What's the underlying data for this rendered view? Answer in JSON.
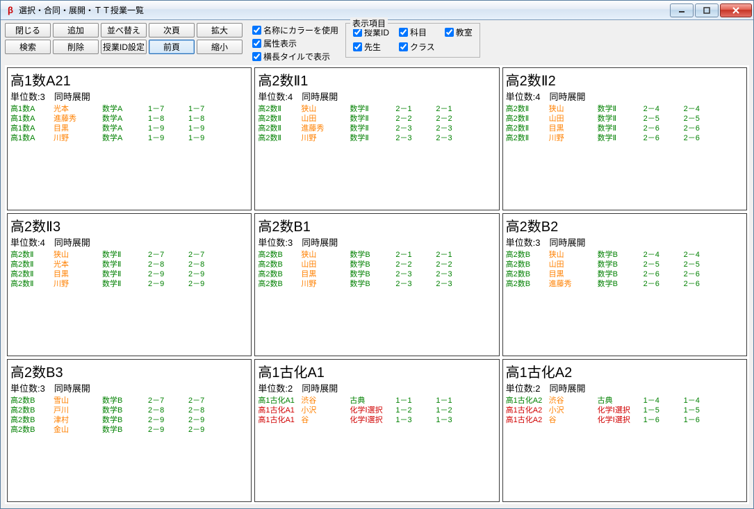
{
  "window": {
    "title": "選択・合同・展開・ＴＴ授業一覧"
  },
  "toolbar": {
    "buttons": [
      [
        "閉じる",
        "追加",
        "並べ替え",
        "次頁",
        "拡大"
      ],
      [
        "検索",
        "削除",
        "授業ID設定",
        "前頁",
        "縮小"
      ]
    ],
    "active": "前頁",
    "checks": {
      "name_color": "名称にカラーを使用",
      "attr_show": "属性表示",
      "tile_wide": "横長タイルで表示"
    },
    "fieldset": {
      "legend": "表示項目",
      "items": {
        "lesson_id": "授業ID",
        "subject": "科目",
        "room": "教室",
        "teacher": "先生",
        "class": "クラス"
      }
    }
  },
  "labels": {
    "units": "単位数:",
    "mode": "同時展開"
  },
  "cards": [
    {
      "title": "高1数A21",
      "units": "3",
      "rows": [
        {
          "id": "高1数A",
          "id_c": "green",
          "tch": "光本",
          "tch_c": "orange",
          "sub": "数学A",
          "sub_c": "green",
          "c1": "1－7",
          "c2": "1－7",
          "cl_c": "green"
        },
        {
          "id": "高1数A",
          "id_c": "green",
          "tch": "進藤秀",
          "tch_c": "orange",
          "sub": "数学A",
          "sub_c": "green",
          "c1": "1－8",
          "c2": "1－8",
          "cl_c": "green"
        },
        {
          "id": "高1数A",
          "id_c": "green",
          "tch": "目黒",
          "tch_c": "orange",
          "sub": "数学A",
          "sub_c": "green",
          "c1": "1－9",
          "c2": "1－9",
          "cl_c": "green"
        },
        {
          "id": "高1数A",
          "id_c": "green",
          "tch": "川野",
          "tch_c": "orange",
          "sub": "数学A",
          "sub_c": "green",
          "c1": "1－9",
          "c2": "1－9",
          "cl_c": "green"
        }
      ]
    },
    {
      "title": "高2数Ⅱ1",
      "units": "4",
      "rows": [
        {
          "id": "高2数Ⅱ",
          "id_c": "green",
          "tch": "狭山",
          "tch_c": "orange",
          "sub": "数学Ⅱ",
          "sub_c": "green",
          "c1": "2－1",
          "c2": "2－1",
          "cl_c": "green"
        },
        {
          "id": "高2数Ⅱ",
          "id_c": "green",
          "tch": "山田",
          "tch_c": "orange",
          "sub": "数学Ⅱ",
          "sub_c": "green",
          "c1": "2－2",
          "c2": "2－2",
          "cl_c": "green"
        },
        {
          "id": "高2数Ⅱ",
          "id_c": "green",
          "tch": "進藤秀",
          "tch_c": "orange",
          "sub": "数学Ⅱ",
          "sub_c": "green",
          "c1": "2－3",
          "c2": "2－3",
          "cl_c": "green"
        },
        {
          "id": "高2数Ⅱ",
          "id_c": "green",
          "tch": "川野",
          "tch_c": "orange",
          "sub": "数学Ⅱ",
          "sub_c": "green",
          "c1": "2－3",
          "c2": "2－3",
          "cl_c": "green"
        }
      ]
    },
    {
      "title": "高2数Ⅱ2",
      "units": "4",
      "rows": [
        {
          "id": "高2数Ⅱ",
          "id_c": "green",
          "tch": "狭山",
          "tch_c": "orange",
          "sub": "数学Ⅱ",
          "sub_c": "green",
          "c1": "2－4",
          "c2": "2－4",
          "cl_c": "green"
        },
        {
          "id": "高2数Ⅱ",
          "id_c": "green",
          "tch": "山田",
          "tch_c": "orange",
          "sub": "数学Ⅱ",
          "sub_c": "green",
          "c1": "2－5",
          "c2": "2－5",
          "cl_c": "green"
        },
        {
          "id": "高2数Ⅱ",
          "id_c": "green",
          "tch": "目黒",
          "tch_c": "orange",
          "sub": "数学Ⅱ",
          "sub_c": "green",
          "c1": "2－6",
          "c2": "2－6",
          "cl_c": "green"
        },
        {
          "id": "高2数Ⅱ",
          "id_c": "green",
          "tch": "川野",
          "tch_c": "orange",
          "sub": "数学Ⅱ",
          "sub_c": "green",
          "c1": "2－6",
          "c2": "2－6",
          "cl_c": "green"
        }
      ]
    },
    {
      "title": "高2数Ⅱ3",
      "units": "4",
      "rows": [
        {
          "id": "高2数Ⅱ",
          "id_c": "green",
          "tch": "狭山",
          "tch_c": "orange",
          "sub": "数学Ⅱ",
          "sub_c": "green",
          "c1": "2－7",
          "c2": "2－7",
          "cl_c": "green"
        },
        {
          "id": "高2数Ⅱ",
          "id_c": "green",
          "tch": "光本",
          "tch_c": "orange",
          "sub": "数学Ⅱ",
          "sub_c": "green",
          "c1": "2－8",
          "c2": "2－8",
          "cl_c": "green"
        },
        {
          "id": "高2数Ⅱ",
          "id_c": "green",
          "tch": "目黒",
          "tch_c": "orange",
          "sub": "数学Ⅱ",
          "sub_c": "green",
          "c1": "2－9",
          "c2": "2－9",
          "cl_c": "green"
        },
        {
          "id": "高2数Ⅱ",
          "id_c": "green",
          "tch": "川野",
          "tch_c": "orange",
          "sub": "数学Ⅱ",
          "sub_c": "green",
          "c1": "2－9",
          "c2": "2－9",
          "cl_c": "green"
        }
      ]
    },
    {
      "title": "高2数B1",
      "units": "3",
      "rows": [
        {
          "id": "高2数B",
          "id_c": "green",
          "tch": "狭山",
          "tch_c": "orange",
          "sub": "数学B",
          "sub_c": "green",
          "c1": "2－1",
          "c2": "2－1",
          "cl_c": "green"
        },
        {
          "id": "高2数B",
          "id_c": "green",
          "tch": "山田",
          "tch_c": "orange",
          "sub": "数学B",
          "sub_c": "green",
          "c1": "2－2",
          "c2": "2－2",
          "cl_c": "green"
        },
        {
          "id": "高2数B",
          "id_c": "green",
          "tch": "目黒",
          "tch_c": "orange",
          "sub": "数学B",
          "sub_c": "green",
          "c1": "2－3",
          "c2": "2－3",
          "cl_c": "green"
        },
        {
          "id": "高2数B",
          "id_c": "green",
          "tch": "川野",
          "tch_c": "orange",
          "sub": "数学B",
          "sub_c": "green",
          "c1": "2－3",
          "c2": "2－3",
          "cl_c": "green"
        }
      ]
    },
    {
      "title": "高2数B2",
      "units": "3",
      "rows": [
        {
          "id": "高2数B",
          "id_c": "green",
          "tch": "狭山",
          "tch_c": "orange",
          "sub": "数学B",
          "sub_c": "green",
          "c1": "2－4",
          "c2": "2－4",
          "cl_c": "green"
        },
        {
          "id": "高2数B",
          "id_c": "green",
          "tch": "山田",
          "tch_c": "orange",
          "sub": "数学B",
          "sub_c": "green",
          "c1": "2－5",
          "c2": "2－5",
          "cl_c": "green"
        },
        {
          "id": "高2数B",
          "id_c": "green",
          "tch": "目黒",
          "tch_c": "orange",
          "sub": "数学B",
          "sub_c": "green",
          "c1": "2－6",
          "c2": "2－6",
          "cl_c": "green"
        },
        {
          "id": "高2数B",
          "id_c": "green",
          "tch": "進藤秀",
          "tch_c": "orange",
          "sub": "数学B",
          "sub_c": "green",
          "c1": "2－6",
          "c2": "2－6",
          "cl_c": "green"
        }
      ]
    },
    {
      "title": "高2数B3",
      "units": "3",
      "rows": [
        {
          "id": "高2数B",
          "id_c": "green",
          "tch": "雪山",
          "tch_c": "orange",
          "sub": "数学B",
          "sub_c": "green",
          "c1": "2－7",
          "c2": "2－7",
          "cl_c": "green"
        },
        {
          "id": "高2数B",
          "id_c": "green",
          "tch": "戸川",
          "tch_c": "orange",
          "sub": "数学B",
          "sub_c": "green",
          "c1": "2－8",
          "c2": "2－8",
          "cl_c": "green"
        },
        {
          "id": "高2数B",
          "id_c": "green",
          "tch": "津村",
          "tch_c": "orange",
          "sub": "数学B",
          "sub_c": "green",
          "c1": "2－9",
          "c2": "2－9",
          "cl_c": "green"
        },
        {
          "id": "高2数B",
          "id_c": "green",
          "tch": "金山",
          "tch_c": "orange",
          "sub": "数学B",
          "sub_c": "green",
          "c1": "2－9",
          "c2": "2－9",
          "cl_c": "green"
        }
      ]
    },
    {
      "title": "高1古化A1",
      "units": "2",
      "rows": [
        {
          "id": "高1古化A1",
          "id_c": "green",
          "tch": "渋谷",
          "tch_c": "orange",
          "sub": "古典",
          "sub_c": "green",
          "c1": "1－1",
          "c2": "1－1",
          "cl_c": "green"
        },
        {
          "id": "高1古化A1",
          "id_c": "red",
          "tch": "小沢",
          "tch_c": "orange",
          "sub": "化学Ⅰ選択",
          "sub_c": "red",
          "c1": "1－2",
          "c2": "1－2",
          "cl_c": "green"
        },
        {
          "id": "高1古化A1",
          "id_c": "red",
          "tch": "谷",
          "tch_c": "orange",
          "sub": "化学Ⅰ選択",
          "sub_c": "red",
          "c1": "1－3",
          "c2": "1－3",
          "cl_c": "green"
        }
      ]
    },
    {
      "title": "高1古化A2",
      "units": "2",
      "rows": [
        {
          "id": "高1古化A2",
          "id_c": "green",
          "tch": "渋谷",
          "tch_c": "orange",
          "sub": "古典",
          "sub_c": "green",
          "c1": "1－4",
          "c2": "1－4",
          "cl_c": "green"
        },
        {
          "id": "高1古化A2",
          "id_c": "red",
          "tch": "小沢",
          "tch_c": "orange",
          "sub": "化学Ⅰ選択",
          "sub_c": "red",
          "c1": "1－5",
          "c2": "1－5",
          "cl_c": "green"
        },
        {
          "id": "高1古化A2",
          "id_c": "red",
          "tch": "谷",
          "tch_c": "orange",
          "sub": "化学Ⅰ選択",
          "sub_c": "red",
          "c1": "1－6",
          "c2": "1－6",
          "cl_c": "green"
        }
      ]
    }
  ]
}
